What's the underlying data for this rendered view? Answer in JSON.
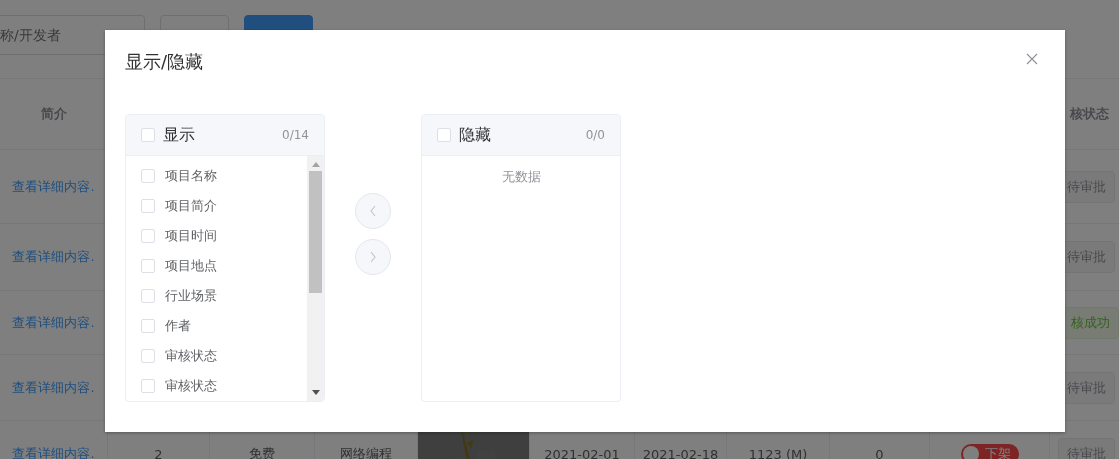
{
  "search": {
    "placeholder": "称/开发者"
  },
  "toolbar_buttons": [
    {
      "kind": "plain"
    },
    {
      "kind": "primary"
    }
  ],
  "table": {
    "columns": [
      {
        "label": "简介"
      },
      {
        "label": "核状态"
      }
    ],
    "rows": [
      {
        "intro": "查看详细内容.",
        "status": "待审批",
        "kind": "pending"
      },
      {
        "intro": "查看详细内容.",
        "status": "待审批",
        "kind": "pending"
      },
      {
        "intro": "查看详细内容.",
        "status": "核成功",
        "kind": "success"
      },
      {
        "intro": "查看详细内容.",
        "status": "待审批",
        "kind": "pending"
      },
      {
        "intro": "查看详细内容.",
        "cells": [
          "2",
          "免费",
          "网络编程"
        ],
        "dates": [
          "2021-02-01",
          "2021-02-18",
          "1123 (M)",
          "0"
        ],
        "switch": {
          "label": "下架",
          "on": false
        },
        "status": "待审批",
        "kind": "pending"
      }
    ]
  },
  "dialog": {
    "title": "显示/隐藏",
    "source": {
      "title": "显示",
      "count": "0/14",
      "checked": false,
      "items": [
        {
          "label": "项目名称",
          "checked": false
        },
        {
          "label": "项目简介",
          "checked": false
        },
        {
          "label": "项目时间",
          "checked": false
        },
        {
          "label": "项目地点",
          "checked": false
        },
        {
          "label": "行业场景",
          "checked": false
        },
        {
          "label": "作者",
          "checked": false
        },
        {
          "label": "审核状态",
          "checked": false
        },
        {
          "label": "审核状态",
          "checked": false
        }
      ]
    },
    "move_buttons": [
      {
        "kind": "left",
        "disabled": true
      },
      {
        "kind": "right",
        "disabled": true
      }
    ],
    "target": {
      "title": "隐藏",
      "count": "0/0",
      "checked": false,
      "empty": "无数据"
    }
  }
}
